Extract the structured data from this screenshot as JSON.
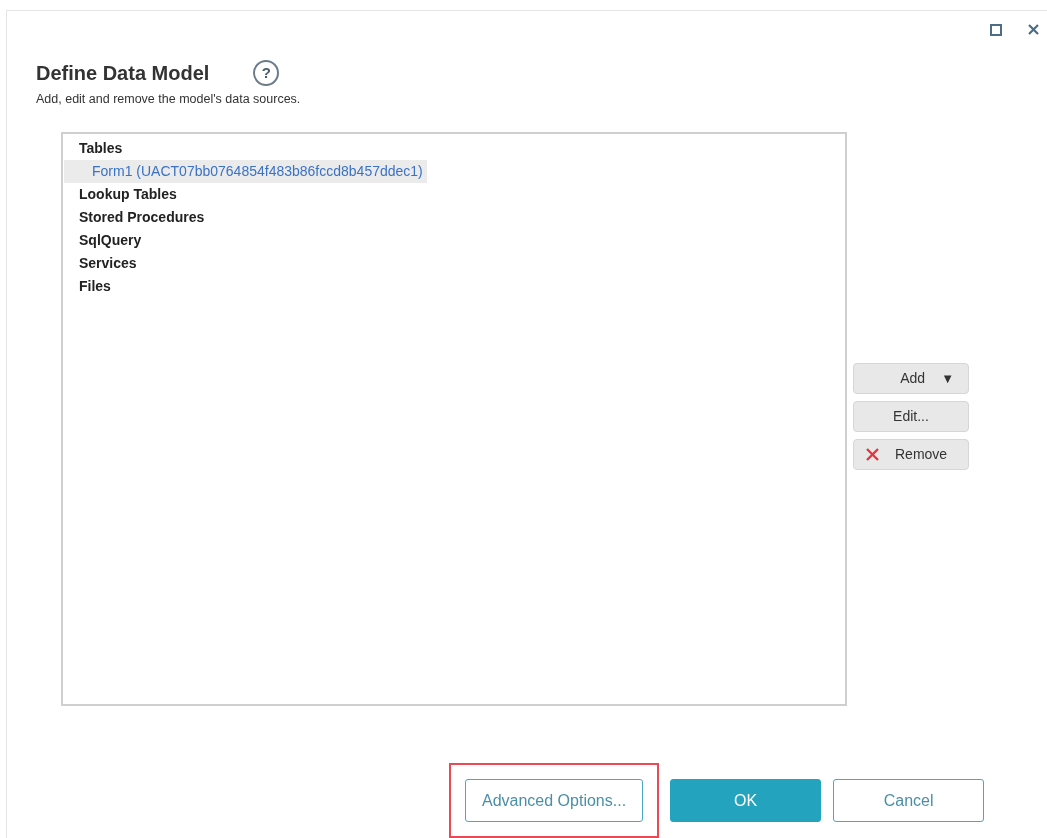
{
  "dialog": {
    "title": "Define Data Model",
    "help": "?",
    "subtitle": "Add, edit and remove the model's data sources."
  },
  "tree": [
    {
      "label": "Tables",
      "selected": false,
      "children": [
        {
          "label": "Form1 (UACT07bb0764854f483b86fccd8b457ddec1)",
          "selected": true
        }
      ]
    },
    {
      "label": "Lookup Tables",
      "selected": false
    },
    {
      "label": "Stored Procedures",
      "selected": false
    },
    {
      "label": "SqlQuery",
      "selected": false
    },
    {
      "label": "Services",
      "selected": false
    },
    {
      "label": "Files",
      "selected": false
    }
  ],
  "side_buttons": [
    {
      "kind": "dropdown",
      "label": "Add",
      "caret": "▼"
    },
    {
      "kind": "plain",
      "label": "Edit..."
    },
    {
      "kind": "remove",
      "label": "Remove"
    }
  ],
  "footer_buttons": [
    {
      "kind": "outline",
      "label": "Advanced Options...",
      "highlighted": true
    },
    {
      "kind": "primary",
      "label": "OK",
      "highlighted": false
    },
    {
      "kind": "outline",
      "label": "Cancel",
      "highlighted": false
    }
  ]
}
